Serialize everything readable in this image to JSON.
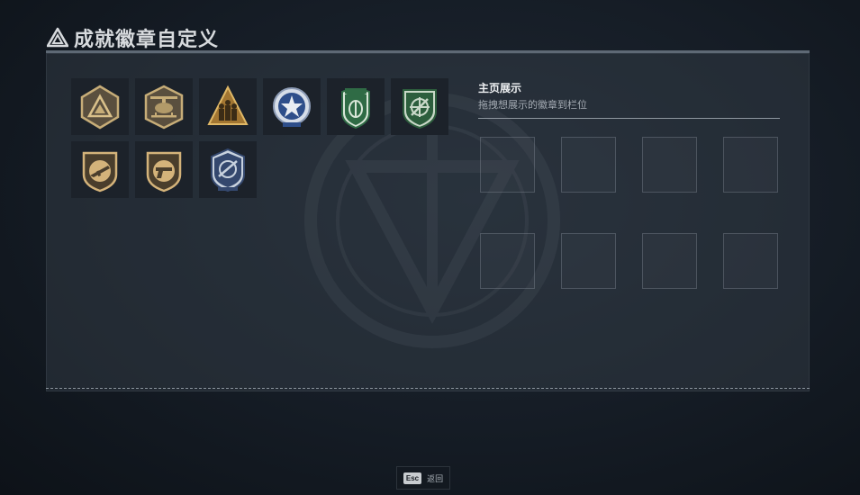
{
  "header": {
    "small_text": "",
    "title": "成就徽章自定义",
    "logo_icon": "triangle-logo-icon"
  },
  "badges": [
    {
      "name": "triangle-badge",
      "colors": [
        "#5a4f3e",
        "#c7ad78"
      ]
    },
    {
      "name": "helicopter-badge",
      "colors": [
        "#5a4f3e",
        "#c7ad78"
      ]
    },
    {
      "name": "soldiers-triangle-badge",
      "colors": [
        "#a27632",
        "#e0b866"
      ]
    },
    {
      "name": "star-wings-badge",
      "colors": [
        "#2e4e8a",
        "#d6dde8"
      ]
    },
    {
      "name": "green-shield-badge",
      "colors": [
        "#2f6b45",
        "#d8e6d8"
      ]
    },
    {
      "name": "green-crosshair-badge",
      "colors": [
        "#2d5e3d",
        "#c9d8c8"
      ]
    },
    {
      "name": "gold-rifle-badge",
      "colors": [
        "#4a3e2c",
        "#d4b37a"
      ]
    },
    {
      "name": "gold-pistol-badge",
      "colors": [
        "#4a3e2c",
        "#d4b37a"
      ]
    },
    {
      "name": "blue-crosshair-badge",
      "colors": [
        "#34486e",
        "#c8d2de"
      ]
    }
  ],
  "showcase": {
    "title": "主页展示",
    "subtitle": "拖拽想展示的徽章到栏位",
    "slot_count": 8
  },
  "footer": {
    "key_label": "Esc",
    "action_label": "返回"
  }
}
